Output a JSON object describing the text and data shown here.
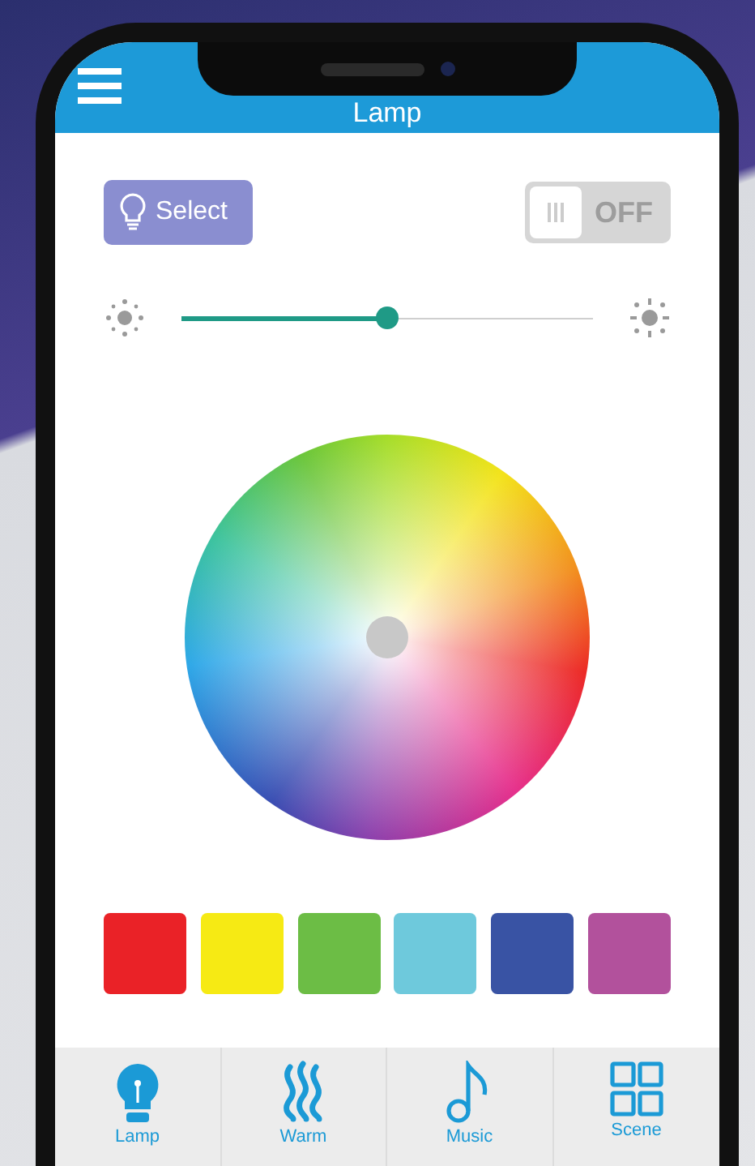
{
  "header": {
    "title": "Lamp"
  },
  "select_button": {
    "label": "Select"
  },
  "power_toggle": {
    "label": "OFF",
    "on": false
  },
  "brightness": {
    "level": 0.5
  },
  "swatches": [
    {
      "color": "#ea2227"
    },
    {
      "color": "#f6ea14"
    },
    {
      "color": "#6cbd45"
    },
    {
      "color": "#6ec9dc"
    },
    {
      "color": "#3953a4"
    },
    {
      "color": "#b2519c"
    }
  ],
  "tabs": [
    {
      "kind": "lamp",
      "label": "Lamp"
    },
    {
      "kind": "warm",
      "label": "Warm"
    },
    {
      "kind": "music",
      "label": "Music"
    },
    {
      "kind": "scene",
      "label": "Scene"
    }
  ]
}
